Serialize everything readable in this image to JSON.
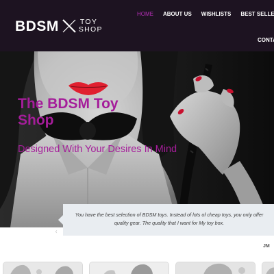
{
  "header": {
    "logo": {
      "main": "BDSM",
      "top": "TOY",
      "bottom": "SHOP"
    },
    "nav": [
      {
        "label": "HOME",
        "active": true
      },
      {
        "label": "ABOUT US",
        "active": false
      },
      {
        "label": "WISHLISTS",
        "active": false
      },
      {
        "label": "BEST SELLERS",
        "active": false
      }
    ],
    "nav_overflow": "CONTA"
  },
  "hero": {
    "title": "The BDSM Toy Shop",
    "subtitle": "Designed With Your Desires In Mind"
  },
  "testimonial": {
    "text": "You have the best selection of BDSM toys. Instead of lots of cheap toys, you only offer quality gear. The quality that I want for My toy box.",
    "author": "JM",
    "prev_arrow": "‹"
  },
  "colors": {
    "header_bg": "#1d1321",
    "accent": "#a51d9a",
    "nav_active": "#b62fb8",
    "lips": "#e0202f",
    "nails": "#c8102e",
    "testimonial_bg": "#e9edf1"
  },
  "icons": {
    "logo_mark": "x-cross-icon",
    "carousel": "chevron-left-icon"
  }
}
